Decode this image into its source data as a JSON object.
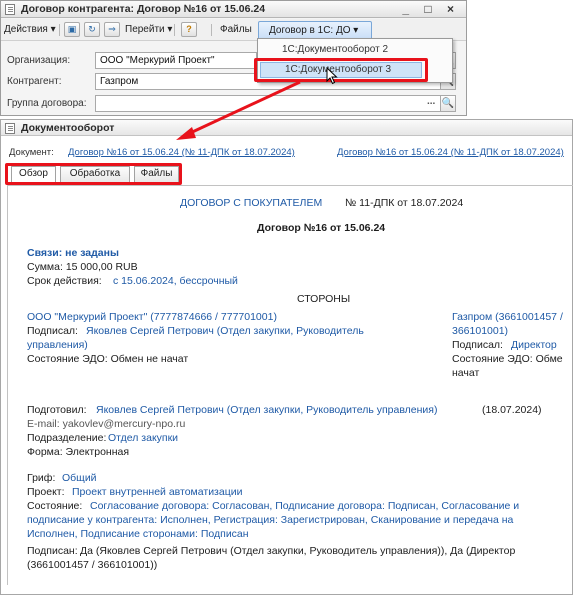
{
  "window1": {
    "title": "Договор контрагента: Договор №16 от 15.06.24",
    "window_buttons": "_ □ ×",
    "toolbar": {
      "actions": "Действия ▾",
      "goto": "Перейти ▾",
      "help": "?",
      "files": "Файлы",
      "do_menu": "Договор в 1С: ДО ▾"
    },
    "fields": {
      "org_label": "Организация:",
      "org_value": "ООО \"Меркурий Проект\"",
      "counterparty_label": "Контрагент:",
      "counterparty_value": "Газпром",
      "group_label": "Группа договора:",
      "group_value": ""
    },
    "menu": {
      "item1": "1С:Документооборот 2",
      "item2": "1С:Документооборот 3"
    }
  },
  "window2": {
    "title": "Документооборот",
    "doc_label": "Документ:",
    "doc_link1": "Договор №16 от 15.06.24 (№ 11-ДПК от 18.07.2024)",
    "doc_link2": "Договор №16 от 15.06.24 (№ 11-ДПК от 18.07.2024)",
    "tabs": [
      "Обзор",
      "Обработка",
      "Файлы"
    ],
    "content": {
      "heading_blue": "ДОГОВОР С ПОКУПАТЕЛЕМ",
      "heading_rest": "№ 11-ДПК от 18.07.2024",
      "subheading": "Договор №16 от 15.06.24",
      "links": "Связи: не заданы",
      "sum": "Сумма: 15 000,00 RUB",
      "term_label": "Срок действия:",
      "term_value": "с 15.06.2024, бессрочный",
      "sides": "СТОРОНЫ",
      "party1": "ООО \"Меркурий Проект\" (7777874666 / 777701001)",
      "party1_signed_label": "Подписал:",
      "party1_signed": "Яковлев Сергей Петрович (Отдел закупки, Руководитель",
      "party1_signed2": "управления)",
      "party1_edo": "Состояние ЭДО: Обмен не начат",
      "party2": "Газпром (3661001457 /",
      "party2b": "366101001)",
      "party2_signed_label": "Подписал:",
      "party2_signed": "Директор",
      "party2_edo": "Состояние ЭДО: Обме",
      "party2_edo2": "начат",
      "prepared_label": "Подготовил:",
      "prepared": "Яковлев Сергей Петрович (Отдел закупки, Руководитель управления)",
      "prepared_date": "(18.07.2024)",
      "email": "E-mail: yakovlev@mercury-npo.ru",
      "dept_label": "Подразделение:",
      "dept": "Отдел закупки",
      "form": "Форма: Электронная",
      "stamp_label": "Гриф:",
      "stamp": "Общий",
      "project_label": "Проект:",
      "project": "Проект внутренней автоматизации",
      "state_label": "Состояние:",
      "state1": "Согласование договора: Согласован, Подписание договора: Подписан, Согласование и",
      "state2": "подписание у контрагента: Исполнен, Регистрация: Зарегистрирован, Сканирование и передача на",
      "state3": "Исполнен, Подписание сторонами: Подписан",
      "signed_label": "Подписан:",
      "signed1": "Да (Яковлев Сергей Петрович (Отдел закупки, Руководитель управления)), Да (Директор",
      "signed2": "(3661001457 / 366101001))"
    }
  },
  "colors": {
    "highlight": "#e8121b",
    "link": "#1f5aa6"
  }
}
